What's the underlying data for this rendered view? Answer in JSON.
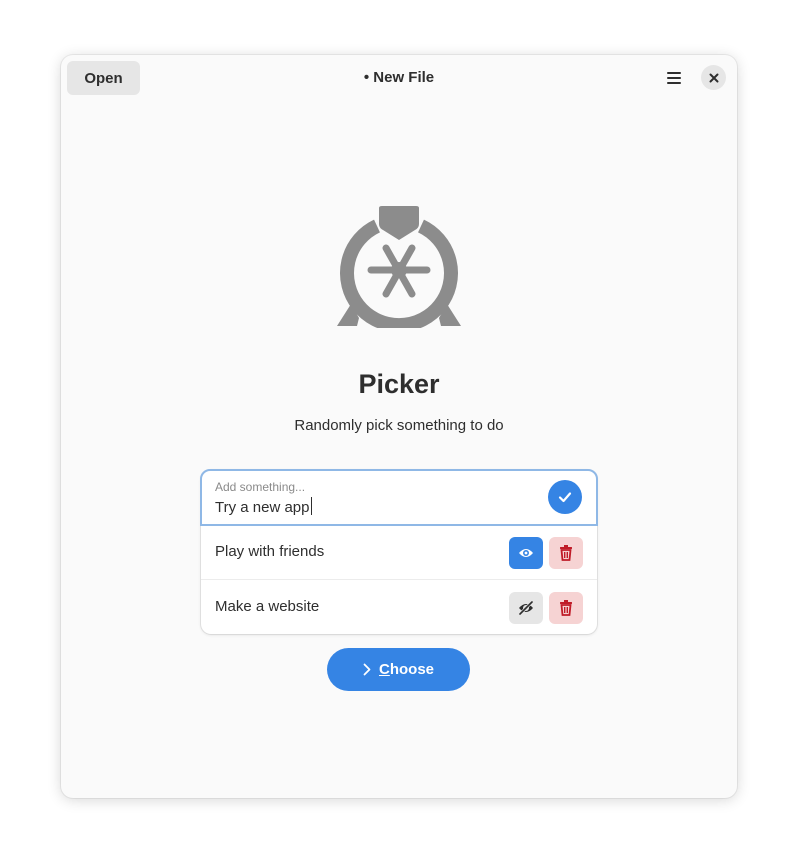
{
  "header": {
    "open_label": "Open",
    "title": "• New File",
    "menu_icon": "hamburger-menu-icon",
    "close_icon": "close-icon"
  },
  "app": {
    "name": "Picker",
    "description": "Randomly pick something to do",
    "icon": "picker-wheel-icon"
  },
  "entry": {
    "placeholder": "Add something...",
    "value": "Try a new app",
    "apply_icon": "checkmark-icon"
  },
  "items": [
    {
      "label": "Play with friends",
      "visible": true,
      "visibility_icon": "eye-icon",
      "delete_icon": "trash-icon"
    },
    {
      "label": "Make a website",
      "visible": false,
      "visibility_icon": "eye-slash-icon",
      "delete_icon": "trash-icon"
    }
  ],
  "choose": {
    "label": "Choose",
    "icon": "chevron-right-icon"
  },
  "colors": {
    "accent": "#3584e4",
    "destructive": "#c01c28",
    "destructive_bg": "#f6d3d3",
    "window_bg": "#fafafa",
    "icon_gray": "#8c8c8c"
  }
}
